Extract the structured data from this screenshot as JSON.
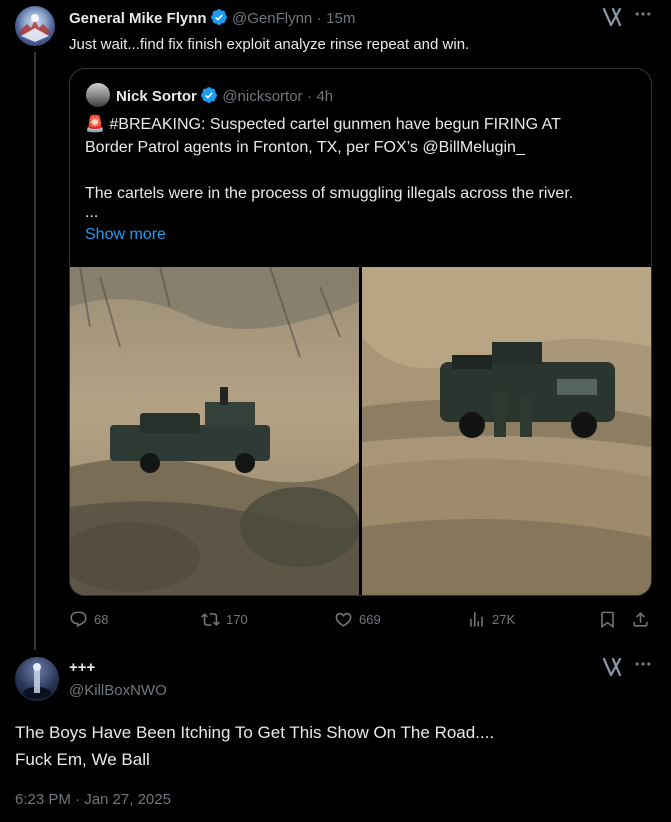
{
  "tweet": {
    "author_name": "General Mike Flynn",
    "author_handle": "@GenFlynn",
    "separator": "·",
    "time_ago": "15m",
    "text": "Just wait...find fix finish exploit analyze rinse repeat and win."
  },
  "quote": {
    "author_name": "Nick Sortor",
    "author_handle": "@nicksortor",
    "separator": "·",
    "time_ago": "4h",
    "emoji": "🚨",
    "line1": "#BREAKING: Suspected cartel gunmen have begun FIRING AT",
    "line2": "Border Patrol agents in Fronton, TX, per FOX’s @BillMelugin_",
    "line3": "The cartels were in the process of smuggling illegals across the river.",
    "ellipsis": "...",
    "show_more": "Show more"
  },
  "actions": {
    "replies": "68",
    "reposts": "170",
    "likes": "669",
    "views": "27K"
  },
  "reply": {
    "author_name": "+++",
    "author_handle": "@KillBoxNWO",
    "text_line1": "The Boys Have Been Itching To Get This Show On The Road....",
    "text_line2": "Fuck Em, We Ball",
    "timestamp": "6:23 PM · Jan 27, 2025"
  },
  "icons": {
    "more": "more-horizontal-icon",
    "grok": "grok-icon",
    "verified": "verified-badge-icon",
    "reply": "reply-icon",
    "repost": "repost-icon",
    "like": "like-icon",
    "views": "views-icon",
    "bookmark": "bookmark-icon",
    "share": "share-icon"
  },
  "colors": {
    "background": "#000000",
    "text": "#e7e9ea",
    "muted": "#71767b",
    "accent": "#1d9bf0",
    "border": "#2f3336"
  }
}
